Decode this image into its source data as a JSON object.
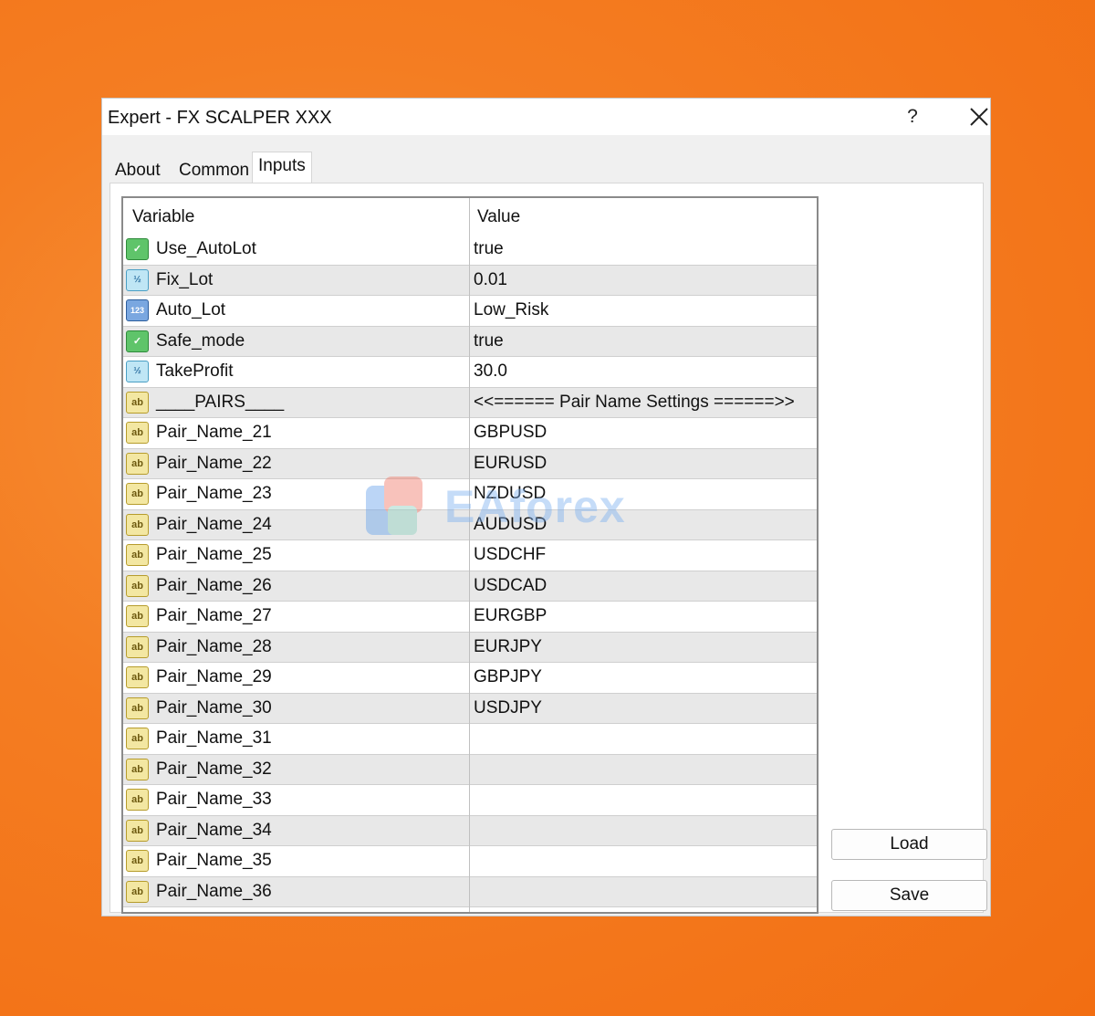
{
  "window": {
    "title": "Expert - FX SCALPER XXX",
    "help_label": "?",
    "close_icon": "close-icon"
  },
  "tabs": [
    {
      "label": "About"
    },
    {
      "label": "Common"
    },
    {
      "label": "Inputs",
      "active": true
    }
  ],
  "grid": {
    "headers": {
      "variable": "Variable",
      "value": "Value"
    },
    "rows": [
      {
        "variable": "Use_AutoLot",
        "value": "true",
        "type": "bool"
      },
      {
        "variable": "Fix_Lot",
        "value": "0.01",
        "type": "double"
      },
      {
        "variable": "Auto_Lot",
        "value": "Low_Risk",
        "type": "int"
      },
      {
        "variable": "Safe_mode",
        "value": "true",
        "type": "bool"
      },
      {
        "variable": "TakeProfit",
        "value": "30.0",
        "type": "double"
      },
      {
        "variable": "____PAIRS____",
        "value": "<<====== Pair Name Settings ======>>",
        "type": "string"
      },
      {
        "variable": "Pair_Name_21",
        "value": "GBPUSD",
        "type": "string"
      },
      {
        "variable": "Pair_Name_22",
        "value": "EURUSD",
        "type": "string"
      },
      {
        "variable": "Pair_Name_23",
        "value": "NZDUSD",
        "type": "string"
      },
      {
        "variable": "Pair_Name_24",
        "value": "AUDUSD",
        "type": "string"
      },
      {
        "variable": "Pair_Name_25",
        "value": "USDCHF",
        "type": "string"
      },
      {
        "variable": "Pair_Name_26",
        "value": "USDCAD",
        "type": "string"
      },
      {
        "variable": "Pair_Name_27",
        "value": "EURGBP",
        "type": "string"
      },
      {
        "variable": "Pair_Name_28",
        "value": "EURJPY",
        "type": "string"
      },
      {
        "variable": "Pair_Name_29",
        "value": "GBPJPY",
        "type": "string"
      },
      {
        "variable": "Pair_Name_30",
        "value": "USDJPY",
        "type": "string"
      },
      {
        "variable": "Pair_Name_31",
        "value": "",
        "type": "string"
      },
      {
        "variable": "Pair_Name_32",
        "value": "",
        "type": "string"
      },
      {
        "variable": "Pair_Name_33",
        "value": "",
        "type": "string"
      },
      {
        "variable": "Pair_Name_34",
        "value": "",
        "type": "string"
      },
      {
        "variable": "Pair_Name_35",
        "value": "",
        "type": "string"
      },
      {
        "variable": "Pair_Name_36",
        "value": "",
        "type": "string"
      }
    ]
  },
  "buttons": {
    "load": "Load",
    "save": "Save"
  },
  "icon_glyphs": {
    "bool": "✓",
    "double": "½",
    "int": "123",
    "string": "ab"
  },
  "watermark": {
    "text": "EAforex"
  }
}
